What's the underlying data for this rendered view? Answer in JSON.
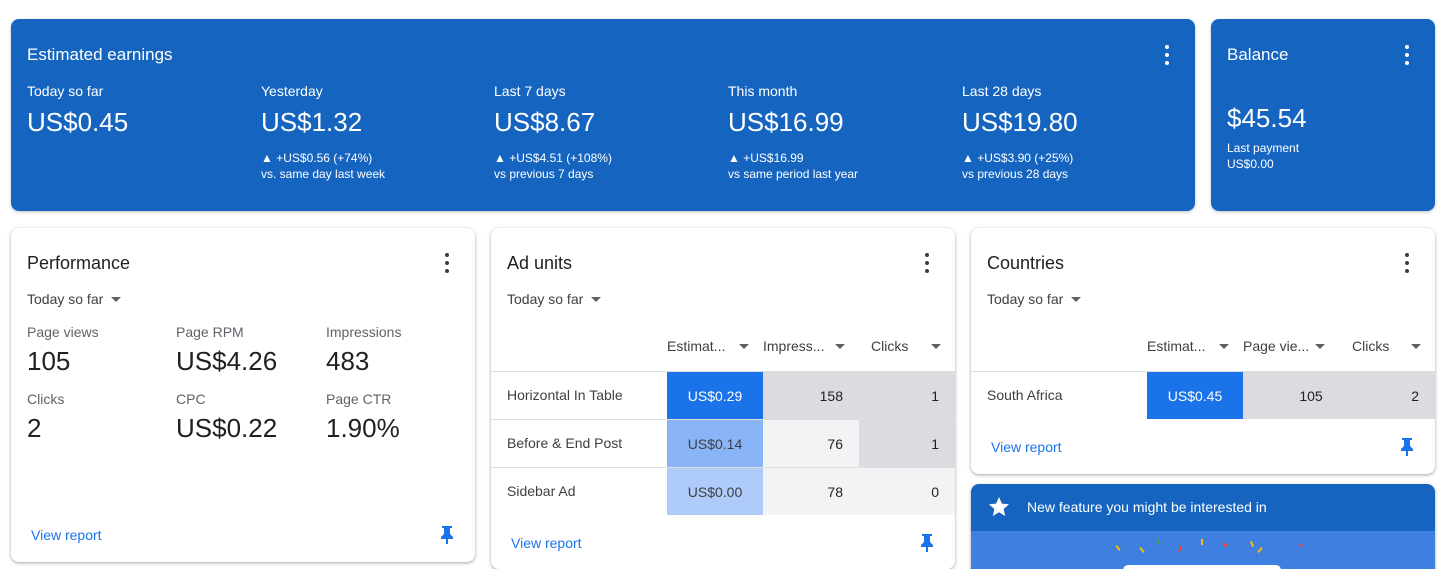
{
  "earnings": {
    "title": "Estimated earnings",
    "metrics": [
      {
        "label": "Today so far",
        "value": "US$0.45",
        "delta": "",
        "compare": ""
      },
      {
        "label": "Yesterday",
        "value": "US$1.32",
        "delta": "▲ +US$0.56 (+74%)",
        "compare": "vs. same day last week"
      },
      {
        "label": "Last 7 days",
        "value": "US$8.67",
        "delta": "▲ +US$4.51 (+108%)",
        "compare": "vs previous 7 days"
      },
      {
        "label": "This month",
        "value": "US$16.99",
        "delta": "▲ +US$16.99",
        "compare": "vs same period last year"
      },
      {
        "label": "Last 28 days",
        "value": "US$19.80",
        "delta": "▲ +US$3.90 (+25%)",
        "compare": "vs previous 28 days"
      }
    ]
  },
  "balance": {
    "title": "Balance",
    "value": "$45.54",
    "last_payment_label": "Last payment",
    "last_payment_value": "US$0.00"
  },
  "performance": {
    "title": "Performance",
    "range": "Today so far",
    "metrics": [
      {
        "label": "Page views",
        "value": "105"
      },
      {
        "label": "Page RPM",
        "value": "US$4.26"
      },
      {
        "label": "Impressions",
        "value": "483"
      },
      {
        "label": "Clicks",
        "value": "2"
      },
      {
        "label": "CPC",
        "value": "US$0.22"
      },
      {
        "label": "Page CTR",
        "value": "1.90%"
      }
    ],
    "link": "View report"
  },
  "ad_units": {
    "title": "Ad units",
    "range": "Today so far",
    "columns": [
      "Estimat...",
      "Impress...",
      "Clicks"
    ],
    "rows": [
      {
        "name": "Horizontal In Table",
        "earnings": "US$0.29",
        "impressions": "158",
        "clicks": "1"
      },
      {
        "name": "Before & End Post",
        "earnings": "US$0.14",
        "impressions": "76",
        "clicks": "1"
      },
      {
        "name": "Sidebar Ad",
        "earnings": "US$0.00",
        "impressions": "78",
        "clicks": "0"
      }
    ],
    "link": "View report"
  },
  "countries": {
    "title": "Countries",
    "range": "Today so far",
    "columns": [
      "Estimat...",
      "Page vie...",
      "Clicks"
    ],
    "rows": [
      {
        "name": "South Africa",
        "earnings": "US$0.45",
        "pageviews": "105",
        "clicks": "2"
      }
    ],
    "link": "View report"
  },
  "feature": {
    "title": "New feature you might be interested in"
  },
  "colors": {
    "brand_blue": "#1565c0",
    "link_blue": "#1a73e8",
    "heat_strong": "#1a73e8",
    "heat_mid": "#8ab4f8",
    "heat_light": "#aecbfa",
    "grey_strong": "#dadce0",
    "grey_light": "#f1f3f4"
  },
  "icons": {
    "menu": "more-vert-icon",
    "pin": "push-pin-icon",
    "star": "star-icon",
    "dropdown": "arrow-drop-down-icon"
  }
}
